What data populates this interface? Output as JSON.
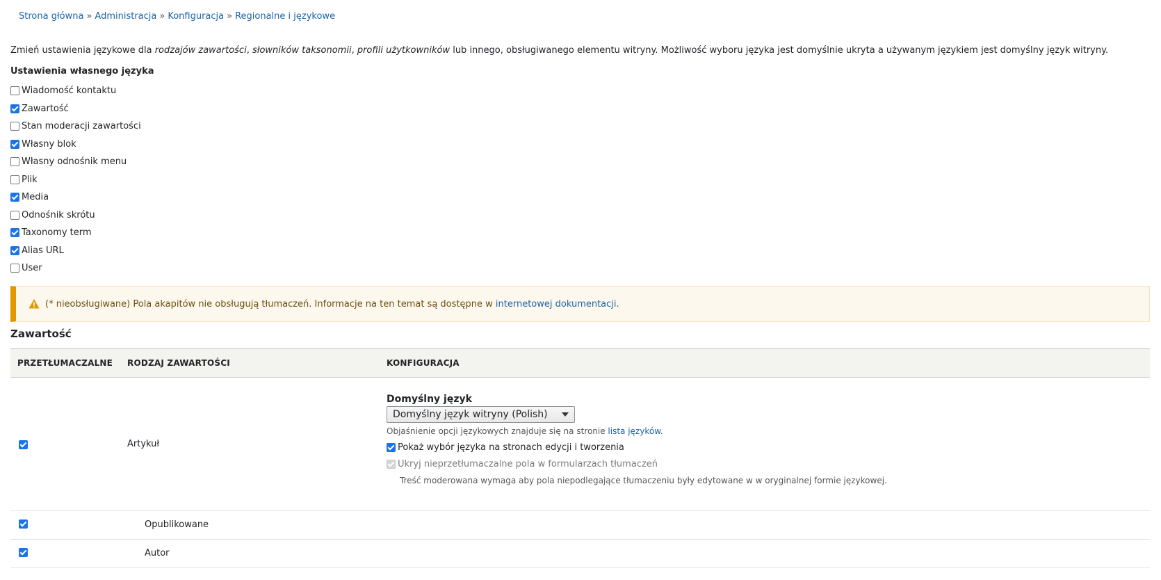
{
  "breadcrumb": {
    "items": [
      "Strona główna",
      "Administracja",
      "Konfiguracja",
      "Regionalne i językowe"
    ],
    "separator": "»"
  },
  "intro": {
    "part1": "Zmień ustawienia językowe dla ",
    "em1": "rodzajów zawartości",
    "sep1": ", ",
    "em2": "słowników taksonomii",
    "sep2": ", ",
    "em3": "profili użytkowników",
    "part2": " lub innego, obsługiwanego elementu witryny. Możliwość wyboru języka jest domyślnie ukryta a używanym językiem jest domyślny język witryny."
  },
  "custom_settings": {
    "title": "Ustawienia własnego języka",
    "items": [
      {
        "label": "Wiadomość kontaktu",
        "checked": false
      },
      {
        "label": "Zawartość",
        "checked": true
      },
      {
        "label": "Stan moderacji zawartości",
        "checked": false
      },
      {
        "label": "Własny blok",
        "checked": true
      },
      {
        "label": "Własny odnośnik menu",
        "checked": false
      },
      {
        "label": "Plik",
        "checked": false
      },
      {
        "label": "Media",
        "checked": true
      },
      {
        "label": "Odnośnik skrótu",
        "checked": false
      },
      {
        "label": "Taxonomy term",
        "checked": true
      },
      {
        "label": "Alias URL",
        "checked": true
      },
      {
        "label": "User",
        "checked": false
      }
    ]
  },
  "warning": {
    "text": "(* nieobsługiwane) Pola akapitów nie obsługują tłumaczeń. Informacje na ten temat są dostępne w ",
    "link": "internetowej dokumentacji",
    "suffix": ".",
    "color": "#e29700"
  },
  "section": {
    "title": "Zawartość"
  },
  "table": {
    "headers": [
      "PRZETŁUMACZALNE",
      "RODZAJ ZAWARTOŚCI",
      "KONFIGURACJA"
    ],
    "main_row": {
      "translatable": true,
      "content_type": "Artykuł",
      "config": {
        "label": "Domyślny język",
        "select_value": "Domyślny język witryny (Polish)",
        "help_text": "Objaśnienie opcji językowych znajduje się na stronie ",
        "help_link": "lista języków",
        "help_suffix": ".",
        "show_selector": {
          "label": "Pokaż wybór języka na stronach edycji i tworzenia",
          "checked": true
        },
        "hide_untranslatable": {
          "label": "Ukryj nieprzetłumaczalne pola w formularzach tłumaczeń",
          "checked": true,
          "disabled": true
        },
        "description": "Treść moderowana wymaga aby pola niepodlegające tłumaczeniu były edytowane w w oryginalnej formie językowej."
      }
    },
    "sub_rows": [
      {
        "label": "Opublikowane",
        "checked": true
      },
      {
        "label": "Autor",
        "checked": true
      }
    ]
  },
  "colors": {
    "link": "#1a63a8",
    "checkbox": "#1a73e8",
    "warning_border": "#e29700"
  }
}
